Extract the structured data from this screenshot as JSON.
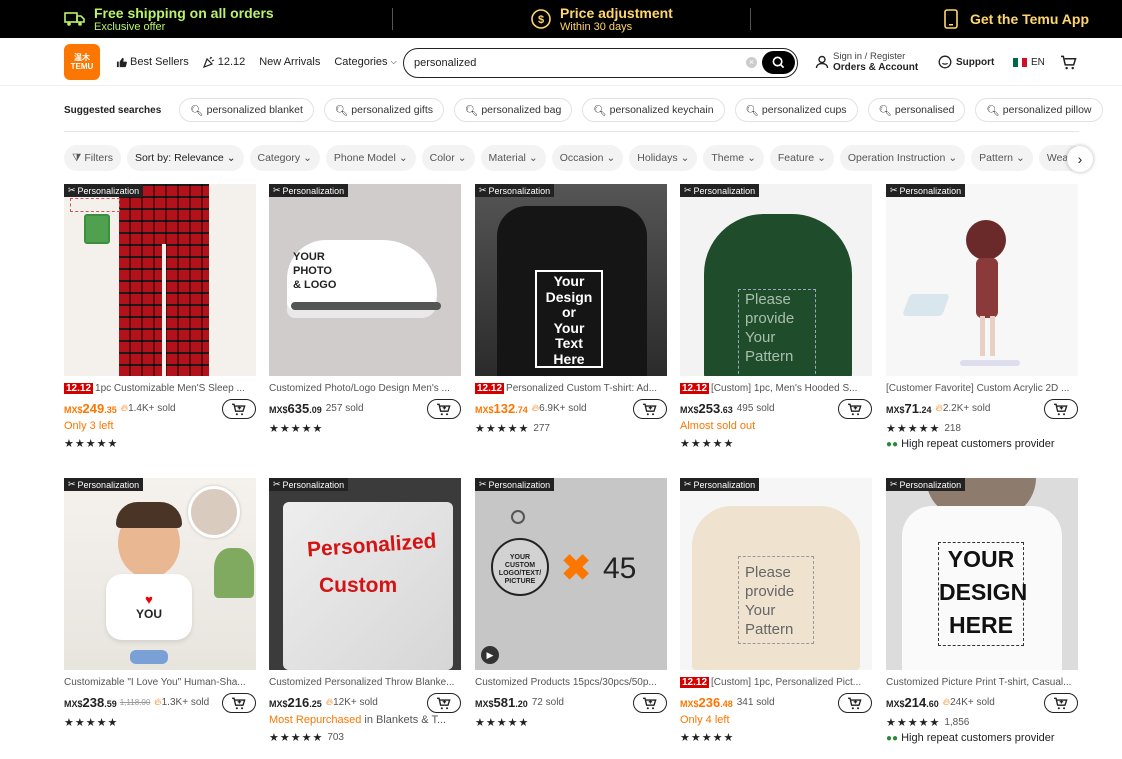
{
  "topbar": {
    "shipping_title": "Free shipping on all orders",
    "shipping_sub": "Exclusive offer",
    "price_title": "Price adjustment",
    "price_sub": "Within 30 days",
    "app_label": "Get the Temu App"
  },
  "header": {
    "logo_line1": "温木",
    "logo_line2": "TEMU",
    "nav": {
      "best_sellers": "Best Sellers",
      "promo": "12.12",
      "new_arrivals": "New Arrivals",
      "categories": "Categories"
    },
    "search_value": "personalized",
    "signin": "Sign in / Register",
    "orders": "Orders & Account",
    "support": "Support",
    "lang": "EN"
  },
  "suggested": {
    "label": "Suggested searches",
    "items": [
      "personalized blanket",
      "personalized gifts",
      "personalized bag",
      "personalized keychain",
      "personalized cups",
      "personalised",
      "personalized pillow"
    ]
  },
  "filters": {
    "items": [
      "Filters",
      "Sort by: Relevance",
      "Category",
      "Phone Model",
      "Color",
      "Material",
      "Occasion",
      "Holidays",
      "Theme",
      "Feature",
      "Operation Instruction",
      "Pattern",
      "Weavi"
    ]
  },
  "badge_label": "Personalization",
  "promo_tag": "12.12",
  "products": [
    {
      "title": "1pc Customizable Men'S Sleep ...",
      "tag": true,
      "currency": "MX$",
      "price_main": "249",
      "price_dec": ".35",
      "orange": true,
      "sold": "1.4K+ sold",
      "hot": true,
      "note": "Only 3 left",
      "stars": "★★★★★",
      "rating_count": "",
      "repeat": ""
    },
    {
      "title": "Customized Photo/Logo Design Men's ...",
      "tag": false,
      "currency": "MX$",
      "price_main": "635",
      "price_dec": ".09",
      "orange": false,
      "sold": "257 sold",
      "hot": false,
      "note": "",
      "stars": "★★★★★",
      "rating_count": "",
      "repeat": ""
    },
    {
      "title": "Personalized Custom T-shirt: Ad...",
      "tag": true,
      "currency": "MX$",
      "price_main": "132",
      "price_dec": ".74",
      "orange": true,
      "sold": "6.9K+ sold",
      "hot": true,
      "note": "",
      "stars": "★★★★★",
      "rating_count": "277",
      "repeat": ""
    },
    {
      "title": "[Custom] 1pc, Men's Hooded S...",
      "tag": true,
      "currency": "MX$",
      "price_main": "253",
      "price_dec": ".63",
      "orange": false,
      "sold": "495 sold",
      "hot": false,
      "note": "Almost sold out",
      "stars": "★★★★★",
      "rating_count": "",
      "repeat": ""
    },
    {
      "title": "[Customer Favorite] Custom Acrylic 2D ...",
      "tag": false,
      "currency": "MX$",
      "price_main": "71",
      "price_dec": ".24",
      "orange": false,
      "sold": "2.2K+ sold",
      "hot": true,
      "note": "",
      "stars": "★★★★★",
      "rating_count": "218",
      "repeat": "High repeat customers provider"
    },
    {
      "title": "Customizable \"I Love You\" Human-Sha...",
      "tag": false,
      "currency": "MX$",
      "price_main": "238",
      "price_dec": ".59",
      "orange": false,
      "old": "1,118.00",
      "sold": "1.3K+ sold",
      "hot": true,
      "note": "",
      "stars": "★★★★★",
      "rating_count": "",
      "repeat": ""
    },
    {
      "title": "Customized Personalized Throw Blanke...",
      "tag": false,
      "currency": "MX$",
      "price_main": "216",
      "price_dec": ".25",
      "orange": false,
      "sold": "12K+ sold",
      "hot": true,
      "note": "Most Repurchased",
      "note_suffix": " in Blankets & T...",
      "stars": "★★★★★",
      "rating_count": "703",
      "repeat": ""
    },
    {
      "title": "Customized Products 15pcs/30pcs/50p...",
      "tag": false,
      "currency": "MX$",
      "price_main": "581",
      "price_dec": ".20",
      "orange": false,
      "sold": "72 sold",
      "hot": false,
      "note": "",
      "stars": "★★★★★",
      "rating_count": "",
      "repeat": ""
    },
    {
      "title": "[Custom] 1pc, Personalized Pict...",
      "tag": true,
      "currency": "MX$",
      "price_main": "236",
      "price_dec": ".48",
      "orange": true,
      "sold": "341 sold",
      "hot": false,
      "note": "Only 4 left",
      "stars": "★★★★★",
      "rating_count": "",
      "repeat": ""
    },
    {
      "title": "Customized Picture Print T-shirt, Casual...",
      "tag": false,
      "currency": "MX$",
      "price_main": "214",
      "price_dec": ".60",
      "orange": false,
      "sold": "24K+ sold",
      "hot": true,
      "note": "",
      "stars": "★★★★★",
      "rating_count": "1,856",
      "repeat": "High repeat customers provider"
    }
  ],
  "image_text": {
    "shoe": [
      "YOUR",
      "PHOTO",
      "& LOGO"
    ],
    "tshirt": [
      "Your",
      "Design",
      "or",
      "Your",
      "Text",
      "Here"
    ],
    "pattern": [
      "Please",
      "provide",
      "Your",
      "Pattern"
    ],
    "pillow_love": "I",
    "pillow_you": "YOU",
    "blanket1": "Personalized",
    "blanket2": "Custom",
    "keychain": [
      "YOUR",
      "CUSTOM",
      "LOGO/TEXT/",
      "PICTURE"
    ],
    "keychain_count": "45",
    "tee_design": [
      "YOUR",
      "DESIGN",
      "HERE"
    ]
  },
  "colors": {
    "accent": "#fb7701",
    "promo_red": "#d40000",
    "topbar_green": "#b9f36b",
    "topbar_yellow": "#ffd66b"
  }
}
